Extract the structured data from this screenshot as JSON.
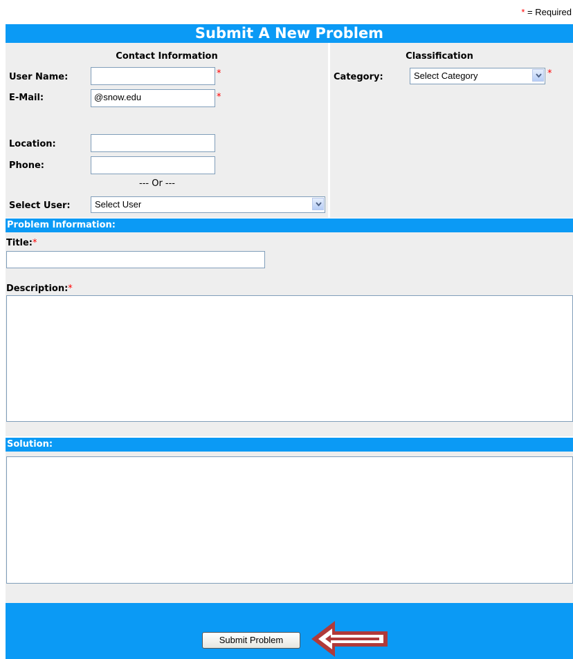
{
  "required_note": {
    "asterisk": "*",
    "text": "= Required"
  },
  "header": {
    "title": "Submit A New Problem"
  },
  "contact": {
    "heading": "Contact Information",
    "user_name_label": "User Name:",
    "user_name_value": "",
    "email_label": "E-Mail:",
    "email_value": "@snow.edu",
    "location_label": "Location:",
    "location_value": "",
    "phone_label": "Phone:",
    "phone_value": "",
    "or_text": "--- Or ---",
    "select_user_label": "Select User:",
    "select_user_value": "Select User"
  },
  "classification": {
    "heading": "Classification",
    "category_label": "Category:",
    "category_value": "Select Category"
  },
  "problem": {
    "section_label": "Problem Information:",
    "title_label": "Title:",
    "title_value": "",
    "description_label": "Description:",
    "description_value": ""
  },
  "solution": {
    "section_label": "Solution:",
    "value": ""
  },
  "footer": {
    "submit_label": "Submit Problem"
  },
  "colors": {
    "accent": "#0b9af5",
    "panel": "#eeeeee",
    "required": "#ff0000",
    "arrow": "#b03a3a"
  },
  "icons": {
    "dropdown": "chevron-down-icon",
    "pointer": "left-arrow-icon"
  }
}
